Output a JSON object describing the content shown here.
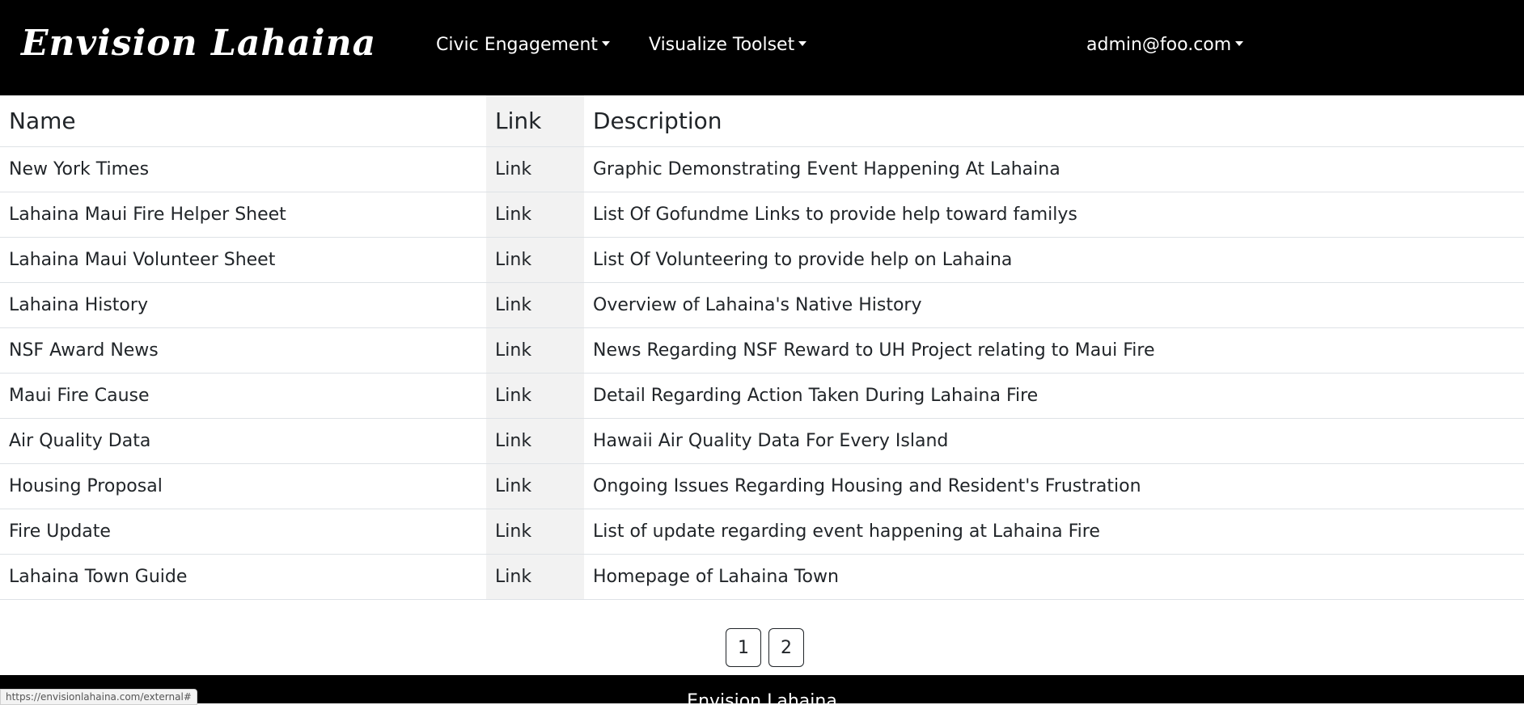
{
  "navbar": {
    "brand": "Envision Lahaina",
    "menu": [
      {
        "label": "Civic Engagement"
      },
      {
        "label": "Visualize Toolset"
      }
    ],
    "user": "admin@foo.com"
  },
  "table": {
    "headers": {
      "name": "Name",
      "link": "Link",
      "description": "Description"
    },
    "rows": [
      {
        "name": "New York Times",
        "link": "Link",
        "description": "Graphic Demonstrating Event Happening At Lahaina"
      },
      {
        "name": "Lahaina Maui Fire Helper Sheet",
        "link": "Link",
        "description": "List Of Gofundme Links to provide help toward familys"
      },
      {
        "name": "Lahaina Maui Volunteer Sheet",
        "link": "Link",
        "description": "List Of Volunteering to provide help on Lahaina"
      },
      {
        "name": "Lahaina History",
        "link": "Link",
        "description": "Overview of Lahaina's Native History"
      },
      {
        "name": "NSF Award News",
        "link": "Link",
        "description": "News Regarding NSF Reward to UH Project relating to Maui Fire"
      },
      {
        "name": "Maui Fire Cause",
        "link": "Link",
        "description": "Detail Regarding Action Taken During Lahaina Fire"
      },
      {
        "name": "Air Quality Data",
        "link": "Link",
        "description": "Hawaii Air Quality Data For Every Island"
      },
      {
        "name": "Housing Proposal",
        "link": "Link",
        "description": "Ongoing Issues Regarding Housing and Resident's Frustration"
      },
      {
        "name": "Fire Update",
        "link": "Link",
        "description": "List of update regarding event happening at Lahaina Fire"
      },
      {
        "name": "Lahaina Town Guide",
        "link": "Link",
        "description": "Homepage of Lahaina Town"
      }
    ]
  },
  "pagination": {
    "pages": [
      "1",
      "2"
    ]
  },
  "footer": {
    "text": "Envision Lahaina"
  },
  "status_bar": {
    "url": "https://envisionlahaina.com/external#"
  }
}
